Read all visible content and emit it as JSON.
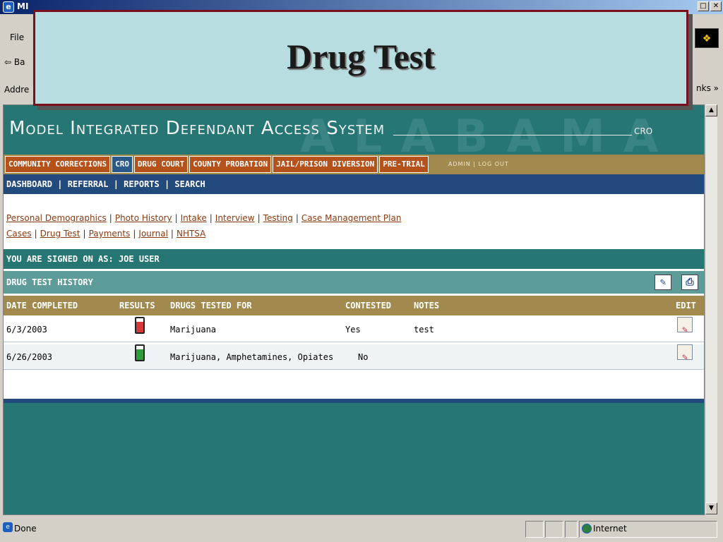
{
  "browser": {
    "title_fragment": "MI",
    "menu_first": "File",
    "back_label": "Ba",
    "address_fragment": "Addre",
    "links_fragment": "nks »",
    "status_text": "Done",
    "zone": "Internet"
  },
  "slide": {
    "title": "Drug Test"
  },
  "app": {
    "system_title": "Model Integrated Defendant Access System",
    "role": "CRO",
    "watermark": "ALABAMA",
    "modules": [
      "COMMUNITY CORRECTIONS",
      "CRO",
      "DRUG COURT",
      "COUNTY PROBATION",
      "JAIL/PRISON DIVERSION",
      "PRE-TRIAL"
    ],
    "admin_links": "ADMIN | LOG OUT",
    "subnav": "DASHBOARD | REFERRAL | REPORTS | SEARCH",
    "links_row1": [
      "Personal Demographics",
      "Photo History",
      "Intake",
      "Interview",
      "Testing",
      "Case Management Plan"
    ],
    "links_row2": [
      "Cases",
      "Drug Test",
      "Payments",
      "Journal",
      "NHTSA"
    ],
    "signed_on": "YOU ARE SIGNED ON AS: JOE USER",
    "section_title": "DRUG TEST HISTORY",
    "table": {
      "headers": [
        "DATE COMPLETED",
        "RESULTS",
        "DRUGS TESTED FOR",
        "CONTESTED",
        "NOTES",
        "EDIT"
      ],
      "rows": [
        {
          "date": "6/3/2003",
          "result": "positive",
          "drugs": "Marijuana",
          "contested": "Yes",
          "notes": "test"
        },
        {
          "date": "6/26/2003",
          "result": "negative",
          "drugs": "Marijuana, Amphetamines, Opiates",
          "contested": "No",
          "notes": ""
        }
      ]
    }
  },
  "colors": {
    "teal": "#267674",
    "gold": "#a28a4e",
    "navy": "#234a7c",
    "orange": "#b5521b",
    "banner_border": "#7a0f1e"
  }
}
